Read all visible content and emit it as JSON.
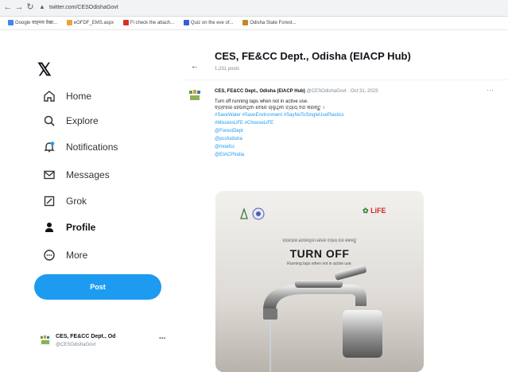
{
  "browser": {
    "url": "twitter.com/CESOdishaGovt",
    "bookmarks": [
      "Google वाङ्‍मय देखा...",
      "eOFDF_EMS.aspx",
      "Fi check the attach...",
      "Quiz on the eve of...",
      "Odisha State Forest..."
    ]
  },
  "sidebar": {
    "items": [
      {
        "label": "Home",
        "icon": "home-icon"
      },
      {
        "label": "Explore",
        "icon": "search-icon"
      },
      {
        "label": "Notifications",
        "icon": "bell-icon"
      },
      {
        "label": "Messages",
        "icon": "mail-icon"
      },
      {
        "label": "Grok",
        "icon": "grok-icon"
      },
      {
        "label": "Profile",
        "icon": "person-icon"
      },
      {
        "label": "More",
        "icon": "more-icon"
      }
    ],
    "post_label": "Post"
  },
  "account": {
    "name": "CES, FE&CC Dept., Od",
    "handle": "@CESOdishaGovt",
    "more": "..."
  },
  "profile": {
    "title": "CES, FE&CC Dept., Odisha (EIACP Hub)",
    "posts_count": "1,231 posts"
  },
  "tweet": {
    "author": "CES, FE&CC Dept., Odisha (EIACP Hub)",
    "handle_date": "@CESOdishaGovt · Oct 31, 2023",
    "lines": [
      "Turn off running taps when not in active use.",
      "ବ୍ୟବହାର ହେଉନଥିବା ବେଳେ ଚାଲୁଥିବା ଟ୍ୟାପ୍ ବନ୍ଦ କରନ୍ତୁ ।"
    ],
    "links": [
      "#SaveWater #SaveEnvironment #SayNoToSingleUsePlastics",
      "#MissionLiFE #ChooseLiFE",
      "@ForestDept",
      "@pcsfodisha",
      "@moefcc",
      "@EIACPIndia"
    ],
    "media": {
      "logo_text": "LiFE",
      "line1": "ବ୍ୟବହାର ହେଉନଥିବା ବେଳେ ଟ୍ୟାପ୍ ବନ୍ଦ କରନ୍ତୁ",
      "headline": "TURN OFF",
      "subline": "Running taps when not in active use."
    }
  },
  "colors": {
    "accent": "#1d9bf0",
    "text": "#0f1419",
    "muted": "#7a8995"
  }
}
